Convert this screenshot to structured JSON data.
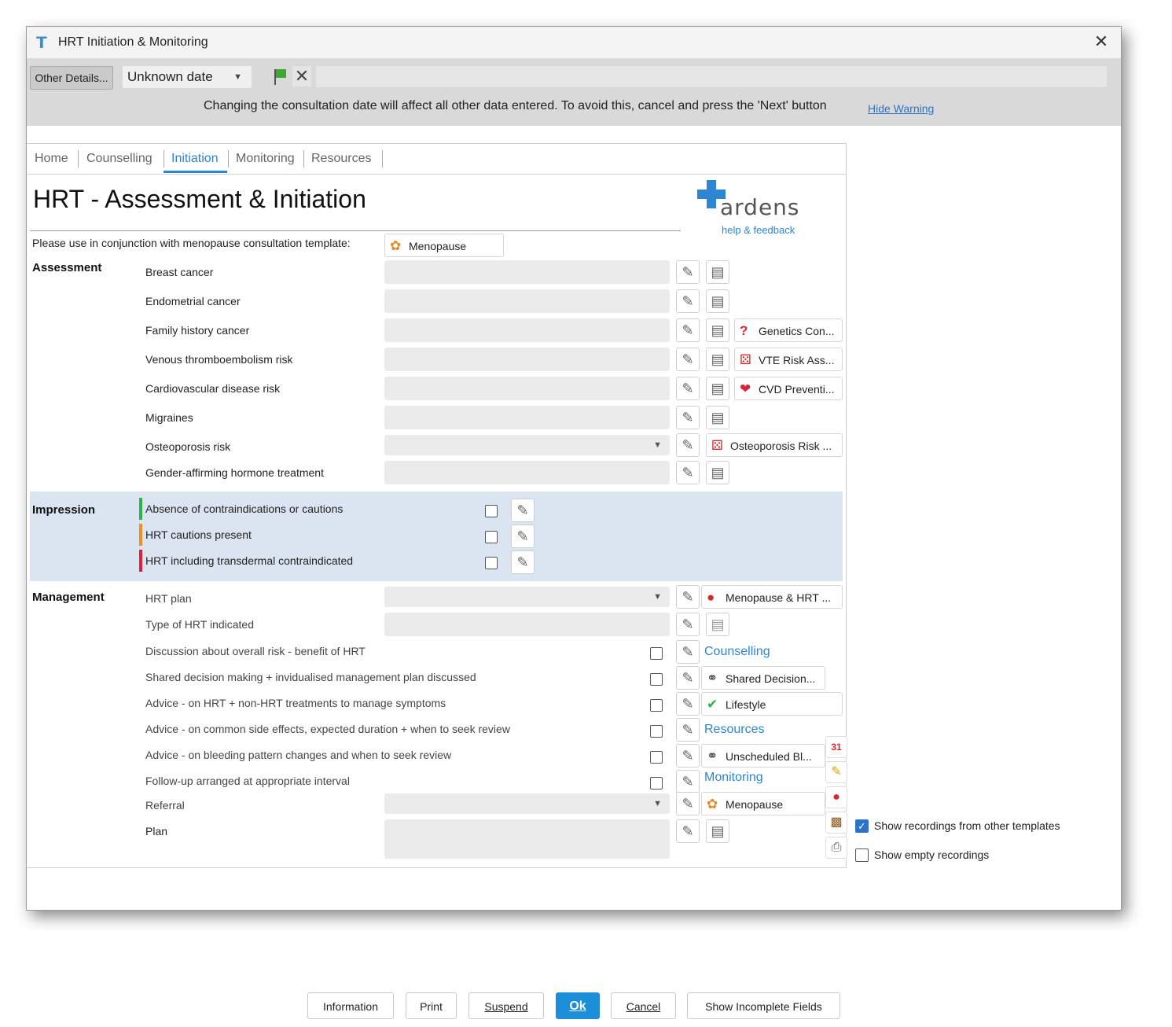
{
  "window": {
    "title": "HRT Initiation & Monitoring"
  },
  "toolbar": {
    "other_details": "Other Details...",
    "date_value": "Unknown date"
  },
  "warning": {
    "text": "Changing the consultation date will affect all other data entered. To avoid this, cancel and press the 'Next' button",
    "hide_label": "Hide Warning"
  },
  "tabs": [
    {
      "label": "Home"
    },
    {
      "label": "Counselling"
    },
    {
      "label": "Initiation"
    },
    {
      "label": "Monitoring"
    },
    {
      "label": "Resources"
    }
  ],
  "page": {
    "heading": "HRT - Assessment & Initiation",
    "conjunction_text": "Please use in conjunction with menopause consultation template:",
    "menopause_chip": "Menopause"
  },
  "logo": {
    "brand": "ardens",
    "help": "help & feedback"
  },
  "assessment": {
    "title": "Assessment",
    "rows": [
      {
        "label": "Breast cancer"
      },
      {
        "label": "Endometrial cancer"
      },
      {
        "label": "Family history cancer",
        "chip": "Genetics Con..."
      },
      {
        "label": "Venous thromboembolism risk",
        "chip": "VTE Risk Ass..."
      },
      {
        "label": "Cardiovascular disease risk",
        "chip": "CVD Preventi..."
      },
      {
        "label": "Migraines"
      },
      {
        "label": "Osteoporosis risk",
        "chip": "Osteoporosis Risk ..."
      },
      {
        "label": "Gender-affirming hormone treatment"
      }
    ]
  },
  "impression": {
    "title": "Impression",
    "rows": [
      {
        "label": "Absence of contraindications or cautions",
        "color": "#2db34a"
      },
      {
        "label": "HRT cautions present",
        "color": "#f28c28"
      },
      {
        "label": "HRT including transdermal contraindicated",
        "color": "#e0203a"
      }
    ]
  },
  "management": {
    "title": "Management",
    "rows": [
      {
        "label": "HRT plan",
        "chip": "Menopause & HRT ..."
      },
      {
        "label": "Type of HRT indicated"
      },
      {
        "label": "Discussion about overall risk - benefit of HRT",
        "link": "Counselling"
      },
      {
        "label": "Shared decision making + invidualised management plan discussed",
        "chip": "Shared Decision..."
      },
      {
        "label": "Advice - on HRT + non-HRT treatments to manage symptoms",
        "chip": "Lifestyle"
      },
      {
        "label": "Advice - on common side effects, expected duration + when to seek review",
        "link": "Resources"
      },
      {
        "label": "Advice - on bleeding pattern changes and when to seek review",
        "chip": "Unscheduled Bl..."
      },
      {
        "label": "Follow-up arranged at appropriate interval",
        "link": "Monitoring"
      },
      {
        "label": "Referral",
        "chip": "Menopause"
      },
      {
        "label": "Plan"
      }
    ]
  },
  "side_options": {
    "show_other": "Show recordings from other templates",
    "show_empty": "Show empty recordings",
    "show_other_checked": true,
    "show_empty_checked": false
  },
  "footer": {
    "information": "Information",
    "print": "Print",
    "suspend": "Suspend",
    "ok": "Ok",
    "cancel": "Cancel",
    "incomplete": "Show Incomplete Fields"
  },
  "colors": {
    "accent": "#2c86d1",
    "impression_bg": "#dbe5f1"
  }
}
